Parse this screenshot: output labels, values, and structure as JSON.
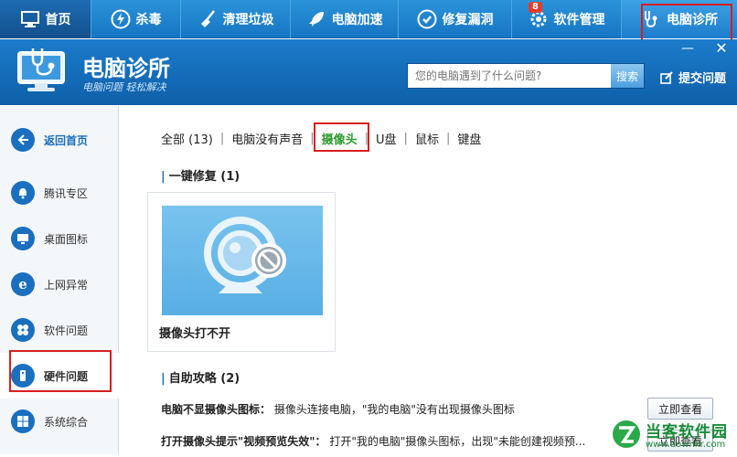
{
  "topnav": {
    "tabs": [
      {
        "label": "首页",
        "icon": "monitor-icon"
      },
      {
        "label": "杀毒",
        "icon": "lightning-icon"
      },
      {
        "label": "清理垃圾",
        "icon": "broom-icon"
      },
      {
        "label": "电脑加速",
        "icon": "rocket-icon"
      },
      {
        "label": "修复漏洞",
        "icon": "shield-icon"
      },
      {
        "label": "软件管理",
        "icon": "gear-icon",
        "badge": "8"
      },
      {
        "label": "电脑诊所",
        "icon": "stethoscope-icon"
      }
    ]
  },
  "header": {
    "title": "电脑诊所",
    "slogan": "电脑问题 轻松解决",
    "search_placeholder": "您的电脑遇到了什么问题?",
    "search_button": "搜索",
    "submit_question": "提交问题",
    "min": "—",
    "close": "✕"
  },
  "sidebar": {
    "back": "返回首页",
    "items": [
      {
        "label": "腾讯专区",
        "icon": "bell-icon"
      },
      {
        "label": "桌面图标",
        "icon": "desktop-icon"
      },
      {
        "label": "上网异常",
        "icon": "ie-icon"
      },
      {
        "label": "软件问题",
        "icon": "puzzle-icon"
      },
      {
        "label": "硬件问题",
        "icon": "hardware-icon"
      },
      {
        "label": "系统综合",
        "icon": "windows-icon"
      }
    ]
  },
  "filters": {
    "items": [
      "全部 (13)",
      "电脑没有声音",
      "摄像头",
      "U盘",
      "鼠标",
      "键盘"
    ],
    "active_index": 2
  },
  "section_fix": {
    "title": "一键修复 (1)",
    "card_label": "摄像头打不开"
  },
  "section_guide": {
    "title": "自助攻略 (2)",
    "rows": [
      {
        "title": "电脑不显摄像头图标：",
        "desc": "摄像头连接电脑，\"我的电脑\"没有出现摄像头图标",
        "button": "立即查看"
      },
      {
        "title": "打开摄像头提示\"视频预览失效\"：",
        "desc": "打开\"我的电脑\"摄像头图标，出现\"未能创建视频预...",
        "button": "立即查看"
      }
    ]
  },
  "watermark": {
    "name": "当客软件园",
    "url": "www.downkr.com"
  },
  "colors": {
    "nav": "#1a7ccb",
    "header": "#1569b6",
    "active_filter": "#2f9b2f",
    "highlight": "#d81e1e"
  }
}
